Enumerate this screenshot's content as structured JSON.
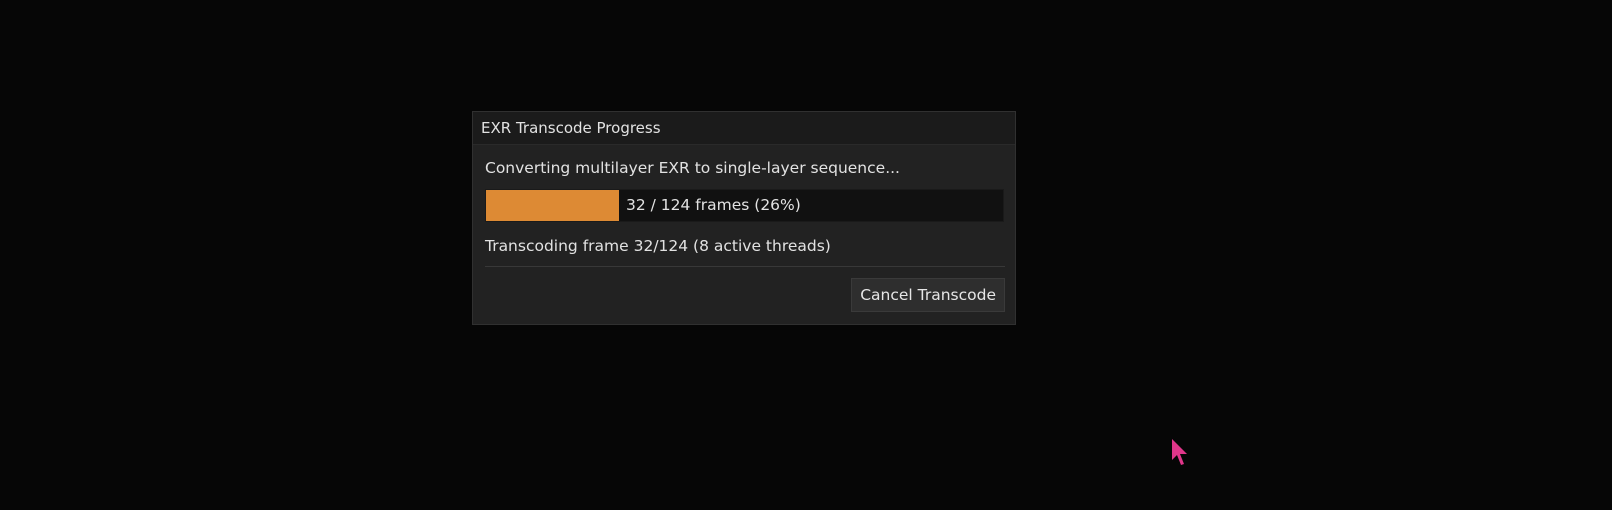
{
  "dialog": {
    "title": "EXR Transcode Progress",
    "message": "Converting multilayer EXR to single-layer sequence...",
    "progress": {
      "current": 32,
      "total": 124,
      "percent": 26,
      "text": "32 / 124 frames (26%)",
      "fill_color": "#dd8a34"
    },
    "status": "Transcoding frame 32/124 (8 active threads)",
    "cancel_label": "Cancel Transcode"
  },
  "cursor": {
    "icon": "mouse-pointer-icon",
    "color": "#e0368a"
  }
}
